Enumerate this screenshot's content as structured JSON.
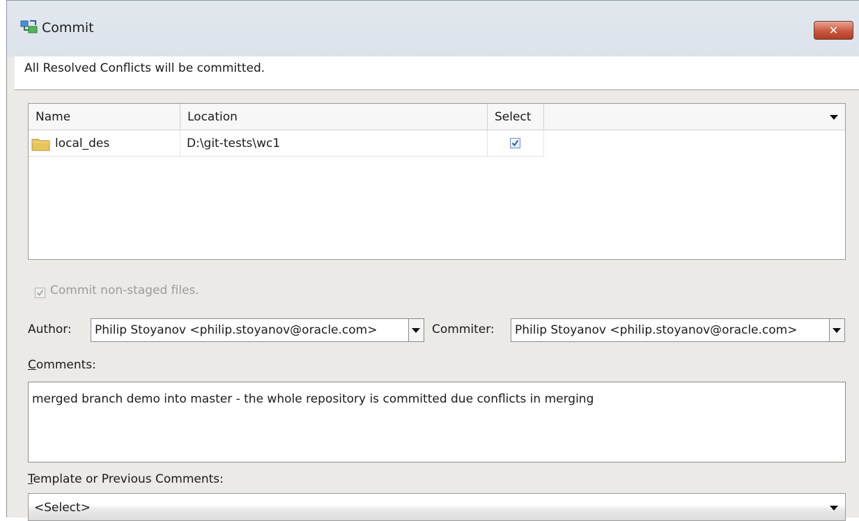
{
  "window": {
    "title": "Commit",
    "close_label": "✕"
  },
  "header": {
    "message": "All Resolved Conflicts will be committed."
  },
  "table": {
    "columns": [
      "Name",
      "Location",
      "Select"
    ],
    "rows": [
      {
        "name": "local_des",
        "location": "D:\\git-tests\\wc1",
        "selected": true
      }
    ]
  },
  "nonstaged": {
    "label": "Commit non-staged files.",
    "checked": true,
    "enabled": false
  },
  "author": {
    "label": "Author:",
    "value": "Philip Stoyanov <philip.stoyanov@oracle.com>"
  },
  "committer": {
    "label": "Commiter:",
    "value": "Philip Stoyanov <philip.stoyanov@oracle.com>"
  },
  "comments": {
    "label_first": "C",
    "label_rest": "omments:",
    "value": "merged branch demo into master - the whole repository is committed due conflicts in merging"
  },
  "template": {
    "label_first": "T",
    "label_rest": "emplate or Previous Comments:",
    "selected": "<Select>"
  },
  "icons": {
    "title": "commit-icon",
    "folder": "folder-icon",
    "close": "close-icon"
  }
}
